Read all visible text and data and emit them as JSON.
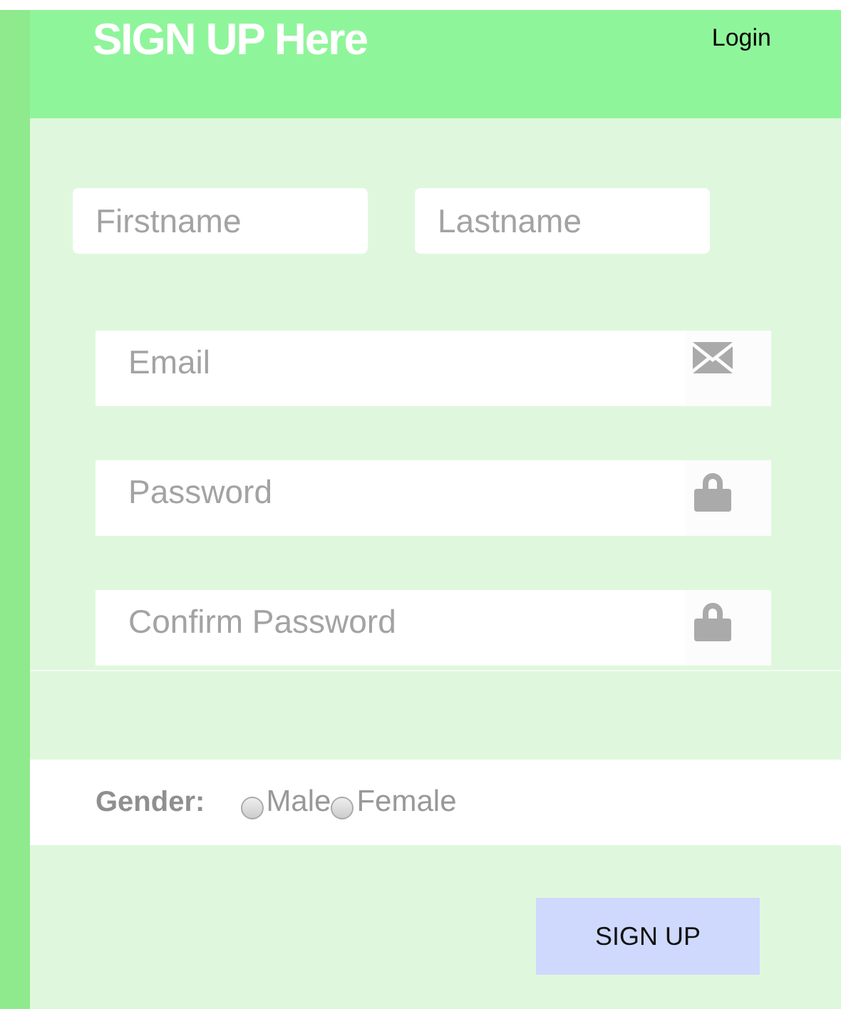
{
  "header": {
    "title": "SIGN UP Here",
    "login_link": "Login"
  },
  "name_fields": [
    {
      "placeholder": "Firstname"
    },
    {
      "placeholder": "Lastname"
    }
  ],
  "icon_fields": [
    {
      "placeholder": "Email",
      "kind": "email"
    },
    {
      "placeholder": "Password",
      "kind": "password"
    },
    {
      "placeholder": "Confirm Password",
      "kind": "password"
    }
  ],
  "gender": {
    "label": "Gender:",
    "options": [
      {
        "label": "Male",
        "selected": false
      },
      {
        "label": "Female",
        "selected": false
      }
    ]
  },
  "submit_button": "SIGN UP"
}
